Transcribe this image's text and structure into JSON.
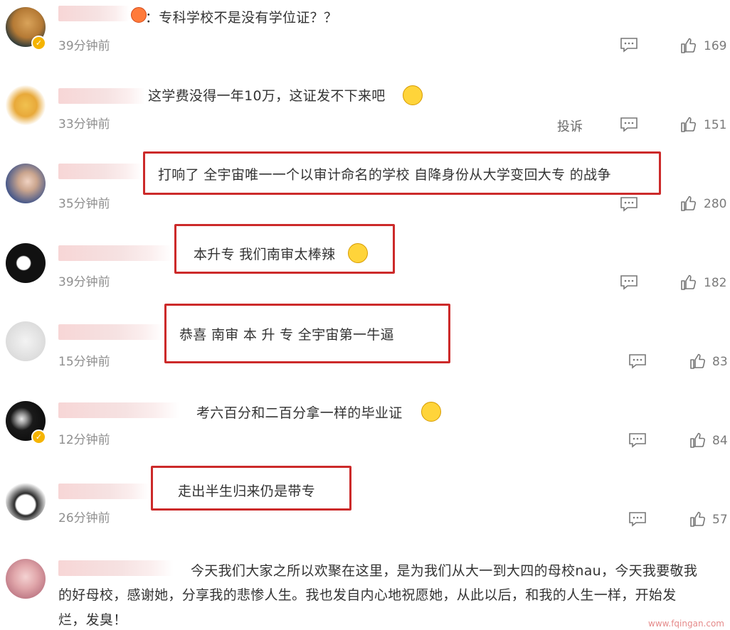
{
  "comments": [
    {
      "text": "：专科学校不是没有学位证？？",
      "time": "39分钟前",
      "likes": "169"
    },
    {
      "text": "这学费没得一年10万，这证发不下来吧",
      "time": "33分钟前",
      "likes": "151",
      "report": "投诉"
    },
    {
      "text": "打响了 全宇宙唯一一个以审计命名的学校 自降身份从大学变回大专 的战争",
      "time": "35分钟前",
      "likes": "280"
    },
    {
      "text": "本升专 我们南审太棒辣",
      "time": "39分钟前",
      "likes": "182"
    },
    {
      "text": "恭喜 南审 本 升 专 全宇宙第一牛逼",
      "time": "15分钟前",
      "likes": "83"
    },
    {
      "text": "考六百分和二百分拿一样的毕业证",
      "time": "12分钟前",
      "likes": "84"
    },
    {
      "text": "走出半生归来仍是带专",
      "time": "26分钟前",
      "likes": "57"
    },
    {
      "text_lines": [
        "今天我们大家之所以欢聚在这里，是为我们从大一到大四的母校nau，今天我要敬我",
        "的好母校，感谢她，分享我的悲惨人生。我也发自内心地祝愿她，从此以后，和我的人生一样，开始发",
        "烂，发臭！"
      ]
    }
  ],
  "watermark": "www.fqingan.com",
  "colors": {
    "highlight_box": "#cc2a2a",
    "verified_badge": "#f5b400"
  }
}
